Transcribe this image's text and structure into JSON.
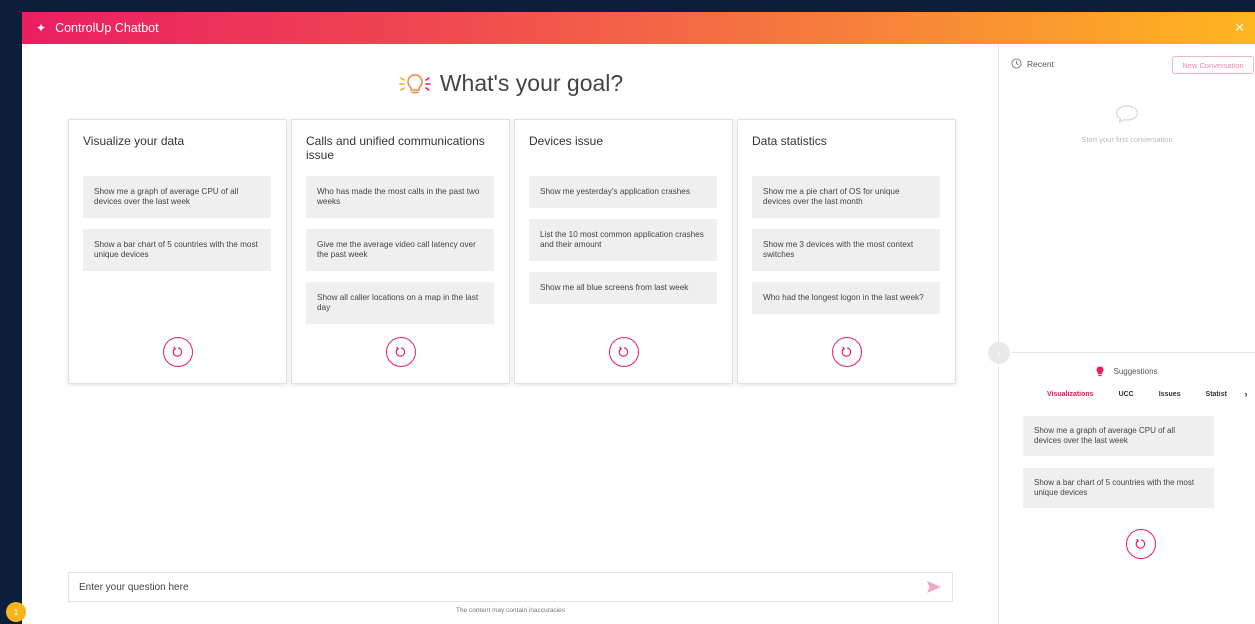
{
  "app": {
    "title": "ControlUp Chatbot",
    "close_glyph": "✕"
  },
  "colors": {
    "brand_pink": "#ea1e63",
    "brand_orange": "#f7843a",
    "brand_yellow": "#ffb61f",
    "prompt_bg": "#efefef"
  },
  "main": {
    "heading": "What's your goal?",
    "categories": [
      {
        "title": "Visualize your data",
        "prompts": [
          "Show me a graph of average CPU of all devices over the last week",
          "Show a bar chart of 5 countries with the most unique devices"
        ]
      },
      {
        "title": "Calls and unified communications issue",
        "prompts": [
          "Who has made the most calls in the past two weeks",
          "Give me the average video call latency over the past week",
          "Show all caller locations on a map in the last day"
        ]
      },
      {
        "title": "Devices issue",
        "prompts": [
          "Show me yesterday's application crashes",
          "List the 10 most common application crashes and their amount",
          "Show me all blue screens from last week"
        ]
      },
      {
        "title": "Data statistics",
        "prompts": [
          "Show me a pie chart of OS for unique devices over the last month",
          "Show me 3 devices with the most context switches",
          "Who had the longest logon in the last week?"
        ]
      }
    ],
    "input": {
      "placeholder": "Enter your question here",
      "value": ""
    },
    "disclaimer": "The content may contain inaccuracies"
  },
  "sidebar": {
    "recent_label": "Recent",
    "new_conversation_label": "New Conversation",
    "empty_state_text": "Start your first conversation",
    "suggestions_label": "Suggestions",
    "tabs": [
      "Visualizations",
      "UCC",
      "Issues",
      "Statist"
    ],
    "active_tab": "Visualizations",
    "suggestions": [
      "Show me a graph of average CPU of all devices over the last week",
      "Show a bar chart of 5 countries with the most unique devices"
    ]
  },
  "notification": {
    "count": "1"
  },
  "icons": {
    "title": "sparkle-icon",
    "heading": "lightbulb-icon",
    "refresh": "refresh-icon",
    "send": "send-icon",
    "recent": "clock-icon",
    "empty": "chat-bubble-icon",
    "suggestions": "lightbulb-icon",
    "tabs_next": "chevron-right-icon",
    "collapse": "chevron-right-icon"
  }
}
